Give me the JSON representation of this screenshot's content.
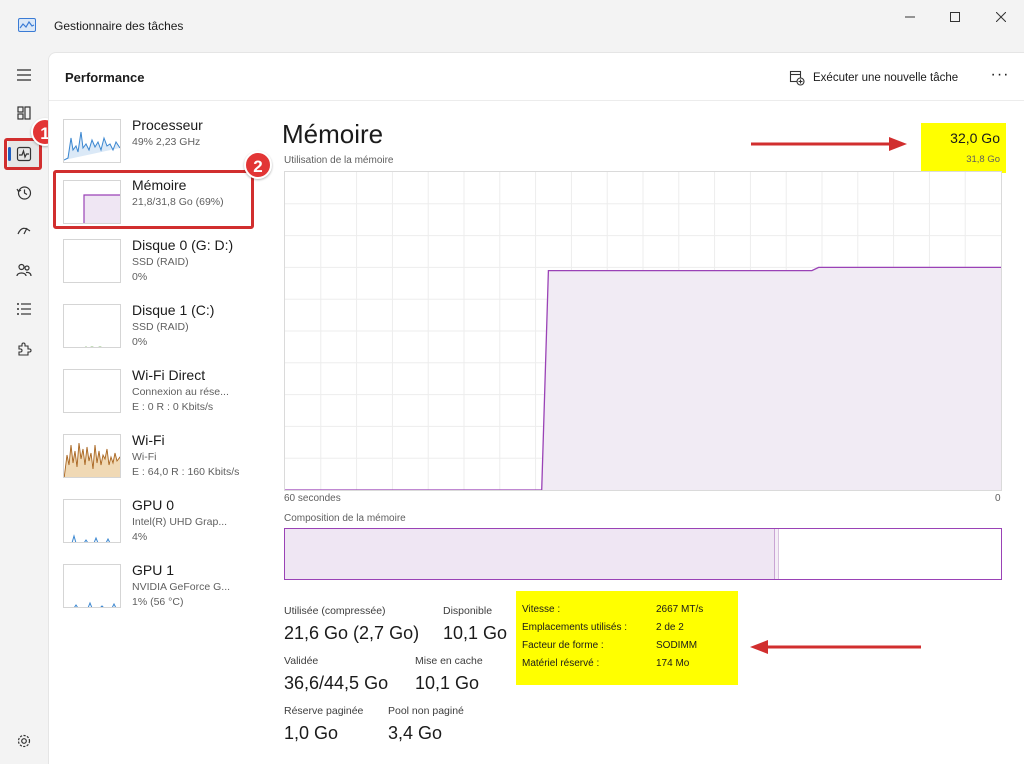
{
  "window": {
    "title": "Gestionnaire des tâches"
  },
  "header": {
    "title": "Performance",
    "run_new_task": "Exécuter une nouvelle tâche",
    "more": "···"
  },
  "devices": [
    {
      "name": "Processeur",
      "sub1": "49% 2,23 GHz",
      "sub2": ""
    },
    {
      "name": "Mémoire",
      "sub1": "21,8/31,8 Go (69%)",
      "sub2": ""
    },
    {
      "name": "Disque 0 (G: D:)",
      "sub1": "SSD (RAID)",
      "sub2": "0%"
    },
    {
      "name": "Disque 1 (C:)",
      "sub1": "SSD (RAID)",
      "sub2": "0%"
    },
    {
      "name": "Wi-Fi Direct",
      "sub1": "Connexion au rése...",
      "sub2": "E : 0 R : 0 Kbits/s"
    },
    {
      "name": "Wi-Fi",
      "sub1": "Wi-Fi",
      "sub2": "E : 64,0 R : 160 Kbits/s"
    },
    {
      "name": "GPU 0",
      "sub1": "Intel(R) UHD Grap...",
      "sub2": "4%"
    },
    {
      "name": "GPU 1",
      "sub1": "NVIDIA GeForce G...",
      "sub2": "1% (56 °C)"
    }
  ],
  "annotations": {
    "badge1": "1",
    "badge2": "2"
  },
  "memory": {
    "title": "Mémoire",
    "usage_label": "Utilisation de la mémoire",
    "total": "32,0 Go",
    "usable": "31,8 Go",
    "axis_left": "60 secondes",
    "axis_right": "0",
    "composition_label": "Composition de la mémoire",
    "used_fraction": 0.685,
    "usage_history_percent": [
      0,
      0,
      0,
      0,
      0,
      0,
      0,
      0,
      0,
      0,
      0,
      0,
      0,
      0,
      0,
      0,
      0,
      0,
      0,
      0,
      0,
      0,
      0,
      0,
      0,
      0,
      0,
      0,
      0,
      0,
      0,
      0,
      0,
      0,
      0,
      0,
      0,
      0,
      0,
      69,
      69,
      69,
      69,
      69,
      69,
      69,
      69,
      69,
      69,
      69,
      69,
      69,
      69,
      69,
      69,
      69,
      69,
      69,
      69,
      69,
      69,
      69,
      69,
      69,
      69,
      69,
      69,
      69,
      69,
      69,
      69,
      69,
      69,
      69,
      69,
      69,
      69,
      69,
      69,
      70,
      70,
      70,
      70,
      70,
      70,
      70,
      70,
      70,
      70,
      70,
      70,
      70,
      70,
      70,
      70,
      70,
      70,
      70,
      70,
      70,
      70,
      70,
      70,
      70,
      70,
      70,
      70
    ]
  },
  "stats": {
    "used_label": "Utilisée (compressée)",
    "used_value": "21,6 Go (2,7 Go)",
    "available_label": "Disponible",
    "available_value": "10,1 Go",
    "committed_label": "Validée",
    "committed_value": "36,6/44,5 Go",
    "cached_label": "Mise en cache",
    "cached_value": "10,1 Go",
    "paged_label": "Réserve paginée",
    "paged_value": "1,0 Go",
    "nonpaged_label": "Pool non paginé",
    "nonpaged_value": "3,4 Go"
  },
  "specs": [
    {
      "label": "Vitesse :",
      "value": "2667 MT/s"
    },
    {
      "label": "Emplacements utilisés :",
      "value": "2 de 2"
    },
    {
      "label": "Facteur de forme :",
      "value": "SODIMM"
    },
    {
      "label": "Matériel réservé :",
      "value": "174 Mo"
    }
  ],
  "colors": {
    "accent_memory": "#9a42b6",
    "highlight": "#ffff00",
    "annotation_red": "#d12e2e"
  }
}
